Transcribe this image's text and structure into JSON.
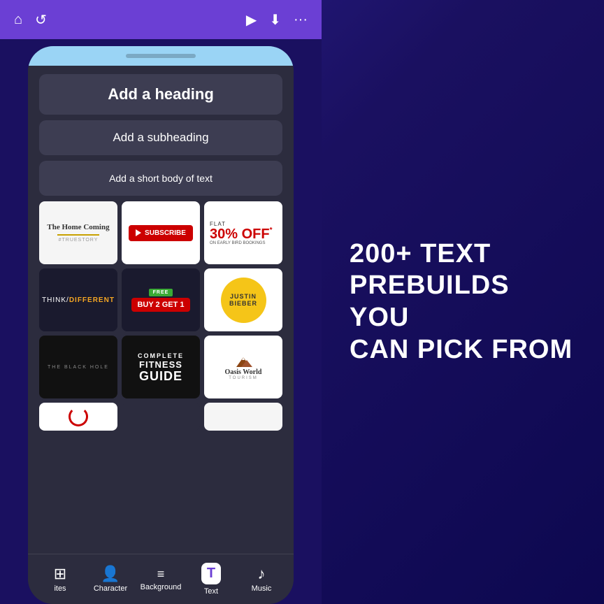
{
  "toolbar": {
    "home_icon": "⌂",
    "back_icon": "↺",
    "play_icon": "▶",
    "download_icon": "⬇",
    "more_icon": "···"
  },
  "phone": {
    "notch": true
  },
  "text_buttons": {
    "heading_label": "Add a heading",
    "subheading_label": "Add a subheading",
    "body_label": "Add a short body of text"
  },
  "prebuilds": [
    {
      "id": "homecoming",
      "title": "The Home Coming",
      "subtitle": "#TRUESTORY"
    },
    {
      "id": "subscribe",
      "label": "SUBSCRIBE"
    },
    {
      "id": "offer",
      "flat": "FLAT",
      "percent": "30% OFF",
      "asterisk": "*",
      "subtext": "ON EARLY BIRD BOOKINGS"
    },
    {
      "id": "think",
      "think": "THINK/",
      "different": "DIFFERENT"
    },
    {
      "id": "buy2get1",
      "free": "FREE",
      "buy": "BUY 2 GET 1"
    },
    {
      "id": "justin",
      "name1": "JUSTIN",
      "name2": "BIEBER"
    },
    {
      "id": "blackhole",
      "text": "THE BLACK HOLE"
    },
    {
      "id": "fitness",
      "complete": "COMPLETE",
      "fitness": "FITNESS",
      "guide": "GUIDE"
    },
    {
      "id": "oasis",
      "title": "Oasis World",
      "subtitle": "TOURISM"
    }
  ],
  "bottom_nav": {
    "items": [
      {
        "id": "templates",
        "icon": "⊞",
        "label": "ites"
      },
      {
        "id": "character",
        "icon": "👤",
        "label": "Character"
      },
      {
        "id": "background",
        "icon": "≡",
        "label": "Background"
      },
      {
        "id": "text",
        "icon": "T",
        "label": "Text",
        "active": true
      },
      {
        "id": "music",
        "icon": "♪",
        "label": "Music"
      }
    ]
  },
  "promo": {
    "line1": "200+ TEXT",
    "line2": "PREBUILDS YOU",
    "line3": "CAN PICK FROM"
  }
}
